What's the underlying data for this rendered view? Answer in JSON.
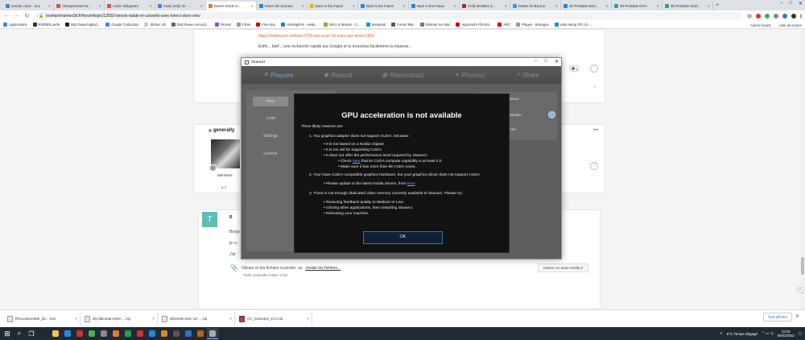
{
  "browser": {
    "tabs": [
      {
        "title": "acsetto corse - Sca",
        "color": "#4a7fd4",
        "active": false
      },
      {
        "title": "Championnat Fra...",
        "color": "#d9534f",
        "active": false
      },
      {
        "title": "Action obligatoire",
        "color": "#d9534f",
        "active": false
      },
      {
        "title": "marty mcfly sti - ...",
        "color": "#4285f4",
        "active": false
      },
      {
        "title": "Besoin d'aide et...",
        "color": "#e07a3a",
        "active": true
      },
      {
        "title": "Kinect 3D Scanner",
        "color": "#1e88e5",
        "active": false
      },
      {
        "title": "Back to the Future",
        "color": "#e6b800",
        "active": false
      },
      {
        "title": "Back to the Future",
        "color": "#1e88e5",
        "active": false
      },
      {
        "title": "Back to the Future",
        "color": "#1e88e5",
        "active": false
      },
      {
        "title": "mcfly Modèles d'...",
        "color": "#b3262b",
        "active": false
      },
      {
        "title": "Makes for Back to",
        "color": "#4a90d9",
        "active": false
      },
      {
        "title": "3D Printable Delo...",
        "color": "#1e88e5",
        "active": false
      },
      {
        "title": "3D Printable DOV...",
        "color": "#26a69a",
        "active": false
      },
      {
        "title": "3D Printable 2016...",
        "color": "#26a69a",
        "active": false
      }
    ],
    "url": "lesimprimantes3d.fr/forum/topic/13502-besoin-daide-et-conseils-avec-kinect-xbox-one/",
    "bookmarks": [
      {
        "label": "Applications",
        "color": "#4285f4"
      },
      {
        "label": "RSRBRLue09",
        "color": "#333"
      },
      {
        "label": "http://www.highsd...",
        "color": "#222"
      },
      {
        "label": "Google Traduction",
        "color": "#4285f4"
      },
      {
        "label": "Slicker 1/5",
        "color": "#ccc"
      },
      {
        "label": "http://www.connecti...",
        "color": "#666"
      },
      {
        "label": "Fitness",
        "color": "#8a55b5"
      },
      {
        "label": "Films",
        "color": "#999"
      },
      {
        "label": "Free Box",
        "color": "#c00"
      },
      {
        "label": "HostingRos - Hebe...",
        "color": "#2b7bbf"
      },
      {
        "label": "Déco & Maison - C...",
        "color": "#7cb342"
      },
      {
        "label": "Novapost",
        "color": "#1e88e5"
      },
      {
        "label": "Forum Mac",
        "color": "#555"
      },
      {
        "label": "Débuter sur Mac",
        "color": "#777"
      },
      {
        "label": "Apprendre PhotoS...",
        "color": "#c00"
      },
      {
        "label": "ARC",
        "color": "#d00"
      },
      {
        "label": "Plages - Bretagne",
        "color": "#999"
      },
      {
        "label": "Liste setup DR 2.0 -...",
        "color": "#1e88e5"
      }
    ],
    "bookmarks_right": [
      "Autres favoris",
      "Liste de lecture"
    ]
  },
  "forum": {
    "post1": {
      "link": "https://makeyvet.net/topic/703-tuto-scan-3d-avec-une-kinect-360/",
      "text": "Enfin... bref... une recherche rapide sur Google et tu trouveras facilement la réponse...",
      "likes": "1"
    },
    "post2": {
      "author": "generally",
      "role": "Membres",
      "posts": "4"
    },
    "editor": {
      "avatar_letter": "T",
      "toolbar": "B",
      "line1": "Bonjo",
      "line2_prefix": "je ",
      "line2_link": "re",
      "line3": "J'ai"
    },
    "attach_text": "Glisser ici les fichiers à joindre, ou ",
    "attach_link": "choisir les fichiers...",
    "size_text": "Taille maximale totale: 0 Mo",
    "insert_media": "Insérer un autre média ▾"
  },
  "skanect": {
    "window_title": "Skanect",
    "steps": [
      "Prepare",
      "Record",
      "Reconstruct",
      "Process",
      "Share"
    ],
    "sidebar": [
      "New",
      "Load",
      "Settings",
      "License"
    ],
    "status": [
      {
        "label": "Loading sensor...",
        "color": "#7a7a7a"
      },
      {
        "label": "GPU unavailable",
        "color": "#c43030"
      },
      {
        "label": "Skanect Free",
        "color": "#d4a900"
      }
    ]
  },
  "modal": {
    "title": "GPU acceleration is not available",
    "intro": "Three likely reasons are:",
    "r1": "1.  You graphics adapter does not support CUDA, because:",
    "r1a": "•  It is not based on a Nvidia chipset.",
    "r1b": "•  It is too old for supporting CUDA.",
    "r1c": "•  It does not offer the performance level required by Skanect:",
    "r1d_pre": "•  Check ",
    "r1d_link": "here",
    "r1d_post": " that its CUDA compute capability is at least 2.0.",
    "r1e": "•  Make sure it has more than 96 CUDA cores.",
    "r2": "2.  Your have CUDA-compatible graphics hardware, but your graphics driver does not support CUDA.",
    "r2a_pre": "•  Please update to the latest Nvidia drivers, from ",
    "r2a_link": "here",
    "r2a_post": ".",
    "r3": "3.  There is not enough dedicated video memory currently available to Skanect. Please try:",
    "r3a": "•  Reducing feedback quality to Medium or Low.",
    "r3b": "•  Closing other applications, then restarting Skanect.",
    "r3c": "•  Rebooting your machine.",
    "ok": "OK"
  },
  "downloads": [
    {
      "name": "ReconstructMe_64....msi",
      "rar": false
    },
    {
      "name": "diy-delorean-time-....zip",
      "rar": false
    },
    {
      "name": "delorean-dmc-12-....zip",
      "rar": false
    },
    {
      "name": "AC_Camotos_v1.0.rar",
      "rar": true
    }
  ],
  "downloads_showall": "Tout afficher",
  "taskbar": {
    "weather": "6°C  Temps dégagé",
    "time": "22:03",
    "date": "05/01/2022",
    "apps": [
      {
        "name": "windows-icon"
      },
      {
        "name": "search-icon"
      },
      {
        "name": "task-view-icon"
      },
      {
        "name": "steam-icon",
        "color": "#1b2838"
      },
      {
        "name": "file-explorer-icon",
        "color": "#f5c242"
      },
      {
        "name": "mail-icon",
        "color": "#1e88e5"
      },
      {
        "name": "app-icon",
        "color": "#c33"
      },
      {
        "name": "chrome-icon",
        "color": "#4caf50"
      },
      {
        "name": "app-icon",
        "color": "#888"
      },
      {
        "name": "app-icon",
        "color": "#e07a3a"
      },
      {
        "name": "app-icon",
        "color": "#2b9b5a"
      },
      {
        "name": "app-icon",
        "color": "#c33"
      },
      {
        "name": "app-icon",
        "color": "#1e88e5"
      },
      {
        "name": "app-icon",
        "color": "#d88a2a"
      },
      {
        "name": "app-icon",
        "color": "#555"
      },
      {
        "name": "app-icon",
        "color": "#2f6fc4"
      },
      {
        "name": "app-icon",
        "color": "#b5651d"
      },
      {
        "name": "skanect-icon",
        "color": "#aaa",
        "active": true
      }
    ]
  }
}
